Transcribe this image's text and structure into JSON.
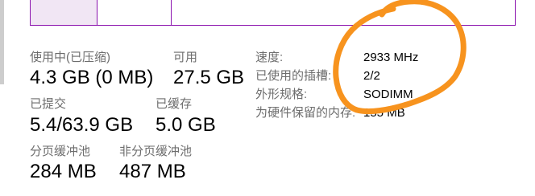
{
  "stats": {
    "in_use": {
      "label": "使用中(已压缩)",
      "value": "4.3 GB (0 MB)"
    },
    "available": {
      "label": "可用",
      "value": "27.5 GB"
    },
    "committed": {
      "label": "已提交",
      "value": "5.4/63.9 GB"
    },
    "cached": {
      "label": "已缓存",
      "value": "5.0 GB"
    },
    "paged_pool": {
      "label": "分页缓冲池",
      "value": "284 MB"
    },
    "non_paged_pool": {
      "label": "非分页缓冲池",
      "value": "487 MB"
    }
  },
  "hardware": {
    "speed": {
      "label": "速度:",
      "value": "2933 MHz"
    },
    "slots_used": {
      "label": "已使用的插槽:",
      "value": "2/2"
    },
    "form_factor": {
      "label": "外形规格:",
      "value": "SODIMM"
    },
    "hardware_reserved": {
      "label": "为硬件保留的内存:",
      "value": "155 MB"
    }
  },
  "memory_bar": {
    "segment_fractions": [
      0.138,
      0.154,
      0.708
    ]
  },
  "colors": {
    "memory_accent": "#8b12ae",
    "memory_in_use_fill": "#f1e6f4",
    "label_text": "#6d6d6d",
    "value_text": "#000000",
    "annotation": "#f7931e",
    "scrollbar": "#cdcdcd"
  }
}
